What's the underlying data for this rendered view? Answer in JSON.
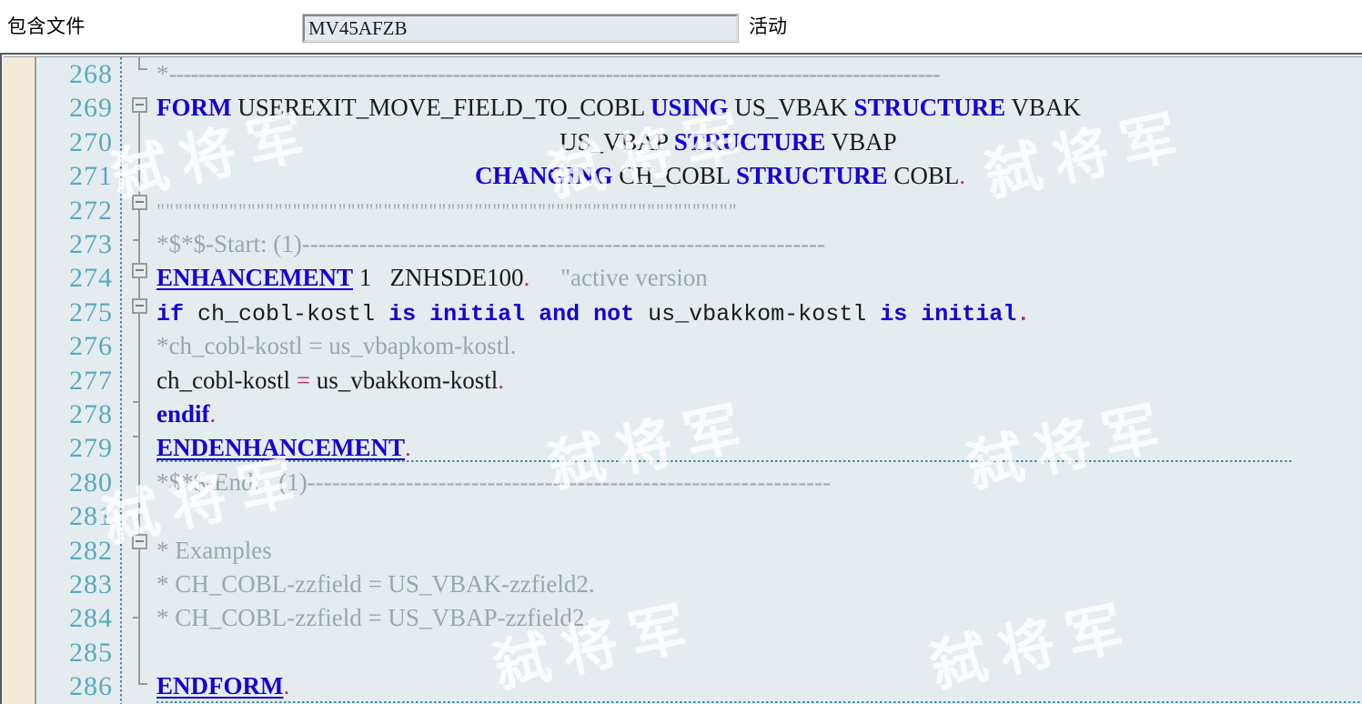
{
  "header": {
    "label": "包含文件",
    "object_name": "MV45AFZB",
    "placeholder": "",
    "status": "活动"
  },
  "editor": {
    "first_line_number": 268,
    "colors": {
      "keyword": "#1400d2",
      "comment": "#9aa6ac",
      "line_number": "#5ba9bd",
      "punctuation": "#c0306b",
      "code_background": "#e4ecf0",
      "margin_strip": "#f2ebd9"
    },
    "lines": [
      {
        "n": "268",
        "text": "*----------------------------------------------------------------------*"
      },
      {
        "n": "269",
        "text": "FORM USEREXIT_MOVE_FIELD_TO_COBL USING US_VBAK STRUCTURE VBAK"
      },
      {
        "n": "270",
        "text": "                                       US_VBAP STRUCTURE VBAP"
      },
      {
        "n": "271",
        "text": "                              CHANGING CH_COBL STRUCTURE COBL."
      },
      {
        "n": "272",
        "text": "\"\"\"\"\"\"\"\"\"\"\"\"\"\"\"\"\"\"\"\"\"\"\"\"\"\"\"\"\"\"\"\"\"\"\"\"\"\"\"\"\"\"\"\"\"\"\"\"\"\"\"\"\"\"\"\""
      },
      {
        "n": "273",
        "text": "*$*$-Start: (1)--------------------------------------------------------"
      },
      {
        "n": "274",
        "text": "ENHANCEMENT 1  ZNHSDE100.    \"active version"
      },
      {
        "n": "275",
        "text": "if ch_cobl-kostl is initial and not us_vbakkom-kostl is initial."
      },
      {
        "n": "276",
        "text": "*ch_cobl-kostl = us_vbapkom-kostl."
      },
      {
        "n": "277",
        "text": "ch_cobl-kostl = us_vbakkom-kostl."
      },
      {
        "n": "278",
        "text": "endif."
      },
      {
        "n": "279",
        "text": "ENDENHANCEMENT."
      },
      {
        "n": "280",
        "text": "*$*$-End:   (1)--------------------------------------------------------"
      },
      {
        "n": "281",
        "text": ""
      },
      {
        "n": "282",
        "text": "* Examples"
      },
      {
        "n": "283",
        "text": "* CH_COBL-zzfield = US_VBAK-zzfield2."
      },
      {
        "n": "284",
        "text": "* CH_COBL-zzfield = US_VBAP-zzfield2."
      },
      {
        "n": "285",
        "text": ""
      },
      {
        "n": "286",
        "text": "ENDFORM."
      }
    ],
    "tokens": {
      "l268_star": "*",
      "l268_rule": "----------------------------------------------------------------------------------------------------------",
      "l269_form": "FORM",
      "l269_name": " USEREXIT_MOVE_FIELD_TO_COBL ",
      "l269_using": "USING",
      "l269_p1": " US_VBAK ",
      "l269_structure": "STRUCTURE",
      "l269_t1": " VBAK",
      "l270_p2": "US_VBAP ",
      "l270_structure": "STRUCTURE",
      "l270_t2": " VBAP",
      "l271_changing": "CHANGING",
      "l271_p3": " CH_COBL ",
      "l271_structure": "STRUCTURE",
      "l271_t3": " COBL",
      "l271_dot": ".",
      "l272_quotes": "\"\"\"\"\"\"\"\"\"\"\"\"\"\"\"\"\"\"\"\"\"\"\"\"\"\"\"\"\"\"\"\"\"\"\"\"\"\"\"\"\"\"\"\"\"\"\"\"\"\"\"\"\"\"\"\"\"\"\"\"\"\"\"\"",
      "l273_comment": "*$*$-Start: (1)----------------------------------------------------------------",
      "l274_kw": "ENHANCEMENT",
      "l274_num": " 1   ",
      "l274_id": "ZNHSDE100",
      "l274_dot": ".",
      "l274_cmt": "     \"active version",
      "l275_if": "if",
      "l275_a": " ch_cobl-kostl ",
      "l275_is1": "is initial",
      "l275_b": " ",
      "l275_and": "and",
      "l275_c": " ",
      "l275_not": "not",
      "l275_d": " us_vbakkom-kostl ",
      "l275_is2": "is initial",
      "l275_dot": ".",
      "l276_cmt": "*ch_cobl-kostl = us_vbapkom-kostl.",
      "l277_a": "ch_cobl-kostl ",
      "l277_eq": "=",
      "l277_b": " us_vbakkom-kostl",
      "l277_dot": ".",
      "l278_kw": "endif",
      "l278_dot": ".",
      "l279_kw": "ENDENHANCEMENT",
      "l279_dot": ".",
      "l280_comment": "*$*$-End:   (1)----------------------------------------------------------------",
      "l282_cmt": "* Examples",
      "l283_cmt": "* CH_COBL-zzfield = US_VBAK-zzfield2.",
      "l284_cmt": "* CH_COBL-zzfield = US_VBAP-zzfield2.",
      "l286_kw": "ENDFORM",
      "l286_dot": "."
    }
  },
  "watermark": {
    "text": "弑将军"
  }
}
